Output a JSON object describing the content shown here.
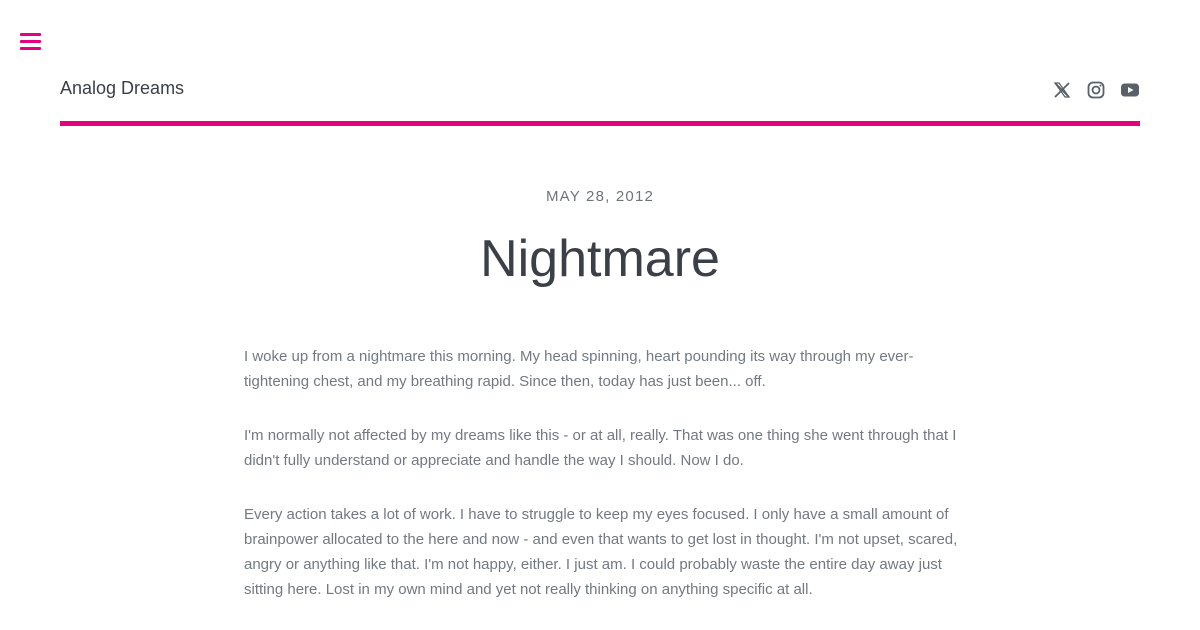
{
  "header": {
    "site_title": "Analog Dreams",
    "social_icons": [
      "x-icon",
      "instagram-icon",
      "youtube-icon"
    ]
  },
  "colors": {
    "accent": "#e5007d",
    "text_dark": "#3b4048",
    "text_body": "#737982"
  },
  "post": {
    "date": "MAY 28, 2012",
    "title": "Nightmare",
    "paragraphs": [
      "I woke up from a nightmare this morning. My head spinning, heart pounding its way through my ever-tightening chest, and my breathing rapid. Since then, today has just been... off.",
      "I'm normally not affected by my dreams like this - or at all, really. That was one thing she went through that I didn't fully understand or appreciate and handle the way I should. Now I do.",
      "Every action takes a lot of work. I have to struggle to keep my eyes focused. I only have a small amount of brainpower allocated to the here and now - and even that wants to get lost in thought. I'm not upset, scared, angry or anything like that. I'm not happy, either. I just am. I could probably waste the entire day away just sitting here. Lost in my own mind and yet not really thinking on anything specific at all."
    ]
  }
}
